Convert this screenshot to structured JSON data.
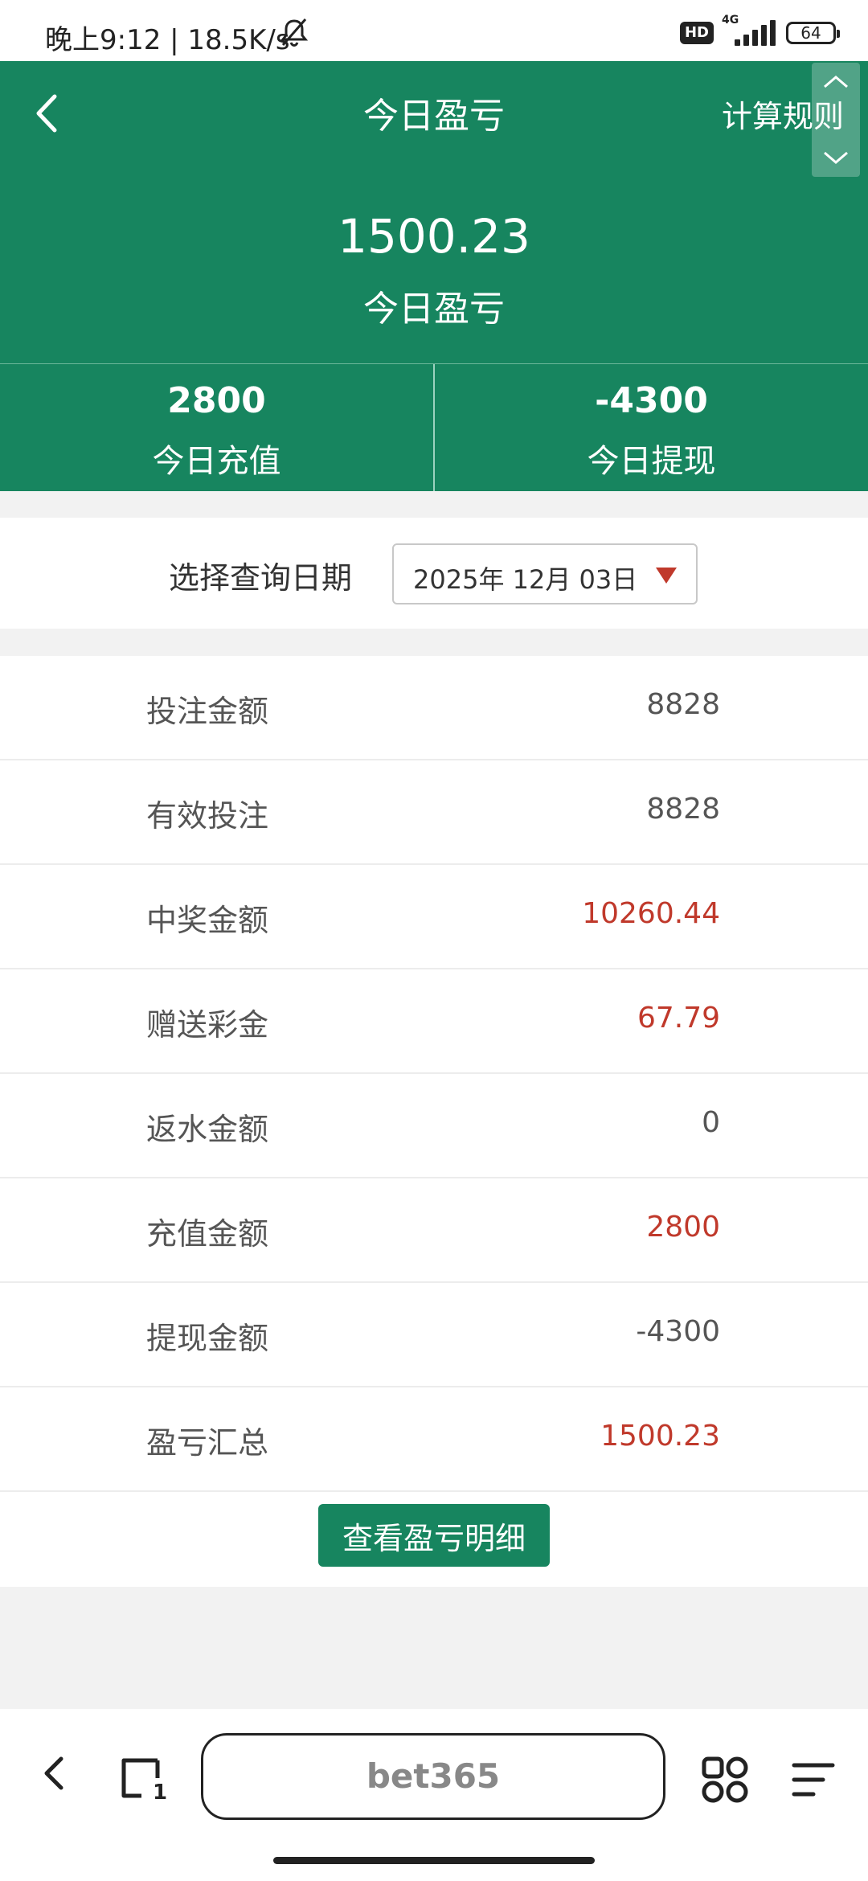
{
  "status_bar": {
    "time_text": "晚上9:12 | 18.5K/s",
    "hd_badge": "HD",
    "network_type": "4G",
    "battery": "64"
  },
  "header": {
    "title": "今日盈亏",
    "rules_link": "计算规则",
    "profit_value": "1500.23",
    "profit_label": "今日盈亏"
  },
  "stats": [
    {
      "value": "2800",
      "label": "今日充值"
    },
    {
      "value": "-4300",
      "label": "今日提现"
    }
  ],
  "date_query": {
    "label": "选择查询日期",
    "selected_date": "2025年 12月 03日"
  },
  "summary": [
    {
      "label": "投注金额",
      "value": "8828",
      "highlight": false
    },
    {
      "label": "有效投注",
      "value": "8828",
      "highlight": false
    },
    {
      "label": "中奖金额",
      "value": "10260.44",
      "highlight": true
    },
    {
      "label": "赠送彩金",
      "value": "67.79",
      "highlight": true
    },
    {
      "label": "返水金额",
      "value": "0",
      "highlight": false
    },
    {
      "label": "充值金额",
      "value": "2800",
      "highlight": true
    },
    {
      "label": "提现金额",
      "value": "-4300",
      "highlight": false
    },
    {
      "label": "盈亏汇总",
      "value": "1500.23",
      "highlight": true
    }
  ],
  "detail_button": "查看盈亏明细",
  "browser": {
    "url_text": "bet365"
  },
  "colors": {
    "brand_green": "#17855f",
    "value_red": "#c0392b"
  },
  "icons": {
    "back": "chevron-left-icon",
    "mute": "bell-off-icon",
    "tabs": "tabs-icon",
    "apps": "apps-grid-icon",
    "menu": "menu-icon"
  }
}
